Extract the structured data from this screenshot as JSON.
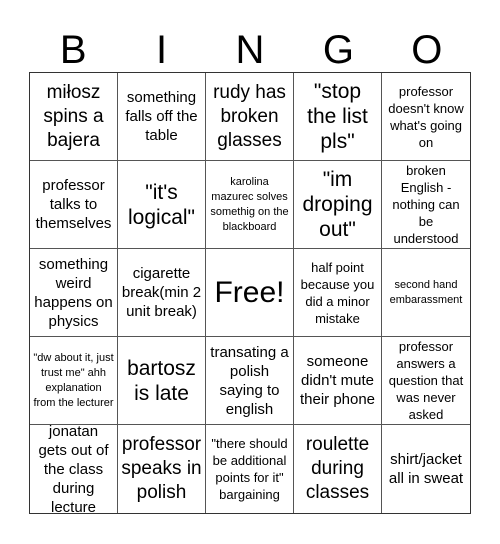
{
  "header": {
    "letters": [
      "B",
      "I",
      "N",
      "G",
      "O"
    ]
  },
  "board": {
    "cells": [
      {
        "text": "miłosz spins a bajera",
        "size": "l"
      },
      {
        "text": "something falls off the table",
        "size": "m"
      },
      {
        "text": "rudy has broken glasses",
        "size": "l"
      },
      {
        "text": "\"stop the list pls\"",
        "size": "xl"
      },
      {
        "text": "professor doesn't know what's going on",
        "size": "s"
      },
      {
        "text": "professor talks to themselves",
        "size": "m"
      },
      {
        "text": "\"it's logical\"",
        "size": "xl"
      },
      {
        "text": "karolina mazurec solves somethig on the blackboard",
        "size": "xs"
      },
      {
        "text": "\"im droping out\"",
        "size": "xl"
      },
      {
        "text": "broken English - nothing can be understood",
        "size": "s"
      },
      {
        "text": "something weird happens on physics",
        "size": "m"
      },
      {
        "text": "cigarette break(min 2 unit break)",
        "size": "m"
      },
      {
        "text": "Free!",
        "size": "free"
      },
      {
        "text": "half point because you did a minor mistake",
        "size": "s"
      },
      {
        "text": "second hand embarassment",
        "size": "xs"
      },
      {
        "text": "\"dw about it, just trust me\" ahh explanation from the lecturer",
        "size": "xs"
      },
      {
        "text": "bartosz is late",
        "size": "xl"
      },
      {
        "text": "transating a polish saying to english",
        "size": "m"
      },
      {
        "text": "someone didn't mute their phone",
        "size": "m"
      },
      {
        "text": "professor answers a question that was never asked",
        "size": "s"
      },
      {
        "text": "jonatan gets out of the class during lecture",
        "size": "m"
      },
      {
        "text": "professor speaks in polish",
        "size": "l"
      },
      {
        "text": "\"there should be additional points for it\" bargaining",
        "size": "s"
      },
      {
        "text": "roulette during classes",
        "size": "l"
      },
      {
        "text": "shirt/jacket all in sweat",
        "size": "m"
      }
    ]
  }
}
